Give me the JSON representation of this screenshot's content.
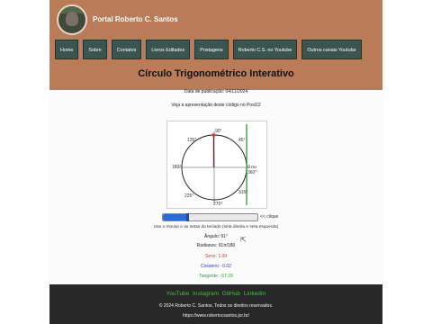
{
  "header": {
    "site_title": "Portal Roberto C. Santos"
  },
  "nav": [
    "Home",
    "Sobre",
    "Contatos",
    "Livros Editados",
    "Postagens",
    "Roberto C.S. no Youtube",
    "Outros canais Youtube"
  ],
  "main": {
    "title": "Círculo Trigonométrico Interativo",
    "pub_date": "Data de publicação: 04/11/2024",
    "pdf_note": "Veja a apresentação deste código no Post12"
  },
  "circle": {
    "labels": {
      "deg90": "90°",
      "deg45": "45°",
      "deg135": "135°",
      "deg180": "180°",
      "deg0": "0 ou 360°",
      "deg225": "225°",
      "deg315": "315°",
      "deg270": "270°"
    },
    "angle_deg": 91
  },
  "controls": {
    "slider_value": 91,
    "slider_max": 360,
    "click_label": "<< clique",
    "hint": "Use o mouse e as setas do teclado (seta direita e seta esquerda)"
  },
  "values": {
    "angle": "Ângulo: 91°",
    "radians": "Radianos: 91π/180",
    "sine": "Seno: 1.00",
    "cosine": "Cosseno: -0.02",
    "tangent": "Tangente: -57.29"
  },
  "colors": {
    "sine": "#e03030",
    "cosine": "#3030c8",
    "tangent": "#2a9a2a"
  },
  "footer": {
    "links": [
      "YouTube",
      "Instagram",
      "GitHub",
      "LinkedIn"
    ],
    "copyright": "© 2024 Roberto C. Santos. Todos os direitos reservados.",
    "url": "https://www.robertocsantos.jor.br/"
  }
}
